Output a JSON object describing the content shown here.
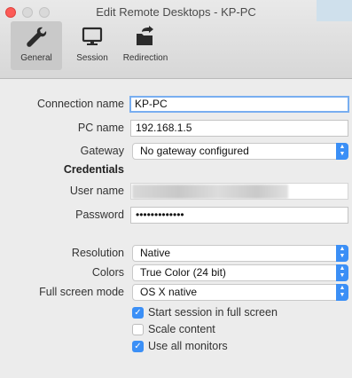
{
  "window": {
    "title": "Edit Remote Desktops - KP-PC"
  },
  "toolbar": {
    "tabs": [
      {
        "label": "General",
        "icon": "wrench-icon",
        "selected": true
      },
      {
        "label": "Session",
        "icon": "monitor-icon",
        "selected": false
      },
      {
        "label": "Redirection",
        "icon": "folder-redirect-icon",
        "selected": false
      }
    ]
  },
  "form": {
    "connection_name_label": "Connection name",
    "connection_name_value": "KP-PC",
    "pc_name_label": "PC name",
    "pc_name_value": "192.168.1.5",
    "gateway_label": "Gateway",
    "gateway_value": "No gateway configured",
    "credentials_heading": "Credentials",
    "user_name_label": "User name",
    "password_label": "Password",
    "password_value": "•••••••••••••",
    "resolution_label": "Resolution",
    "resolution_value": "Native",
    "colors_label": "Colors",
    "colors_value": "True Color (24 bit)",
    "fullscreen_label": "Full screen mode",
    "fullscreen_value": "OS X native",
    "options": [
      {
        "label": "Start session in full screen",
        "checked": true
      },
      {
        "label": "Scale content",
        "checked": false
      },
      {
        "label": "Use all monitors",
        "checked": true
      }
    ]
  },
  "colors": {
    "accent": "#3b8ff6",
    "close_button": "#fc5b57",
    "focus_ring": "#78aef0"
  }
}
